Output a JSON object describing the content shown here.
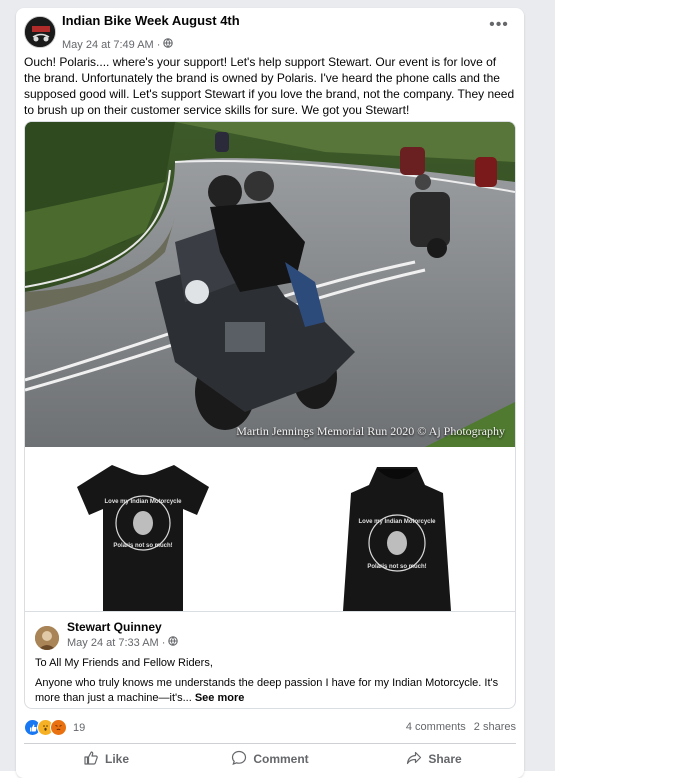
{
  "post": {
    "group_name": "Indian Bike Week August 4th",
    "timestamp": "May 24 at 7:49 AM",
    "separator": "·",
    "text": "Ouch! Polaris.... where's your support! Let's help support Stewart.  Our event is for love of the brand. Unfortunately the brand is owned by Polaris. I've heard the phone calls and the supposed good will. Let's support Stewart if you love the brand, not the company. They need to brush up on their customer service skills for sure. We got you Stewart!",
    "more_label": "•••"
  },
  "photo": {
    "caption": "Martin Jennings Memorial Run 2020 © Aj Photography"
  },
  "merch": {
    "print_top": "Love my Indian Motorcycle",
    "print_bottom": "Polaris not so much!"
  },
  "shared_post": {
    "author": "Stewart Quinney",
    "timestamp": "May 24 at 7:33 AM",
    "separator": "·",
    "greeting": "To All My Friends and Fellow Riders,",
    "body": "Anyone who truly knows me understands the deep passion I have for my Indian Motorcycle. It's more than just a machine—it's...",
    "see_more": "See more"
  },
  "stats": {
    "reaction_count": "19",
    "comments": "4 comments",
    "shares": "2 shares"
  },
  "actions": {
    "like": "Like",
    "comment": "Comment",
    "share": "Share"
  },
  "colors": {
    "like_blue": "#1877f2",
    "angry_orange": "#f7b125",
    "love_red": "#f33e58",
    "meta_gray": "#65676b"
  }
}
